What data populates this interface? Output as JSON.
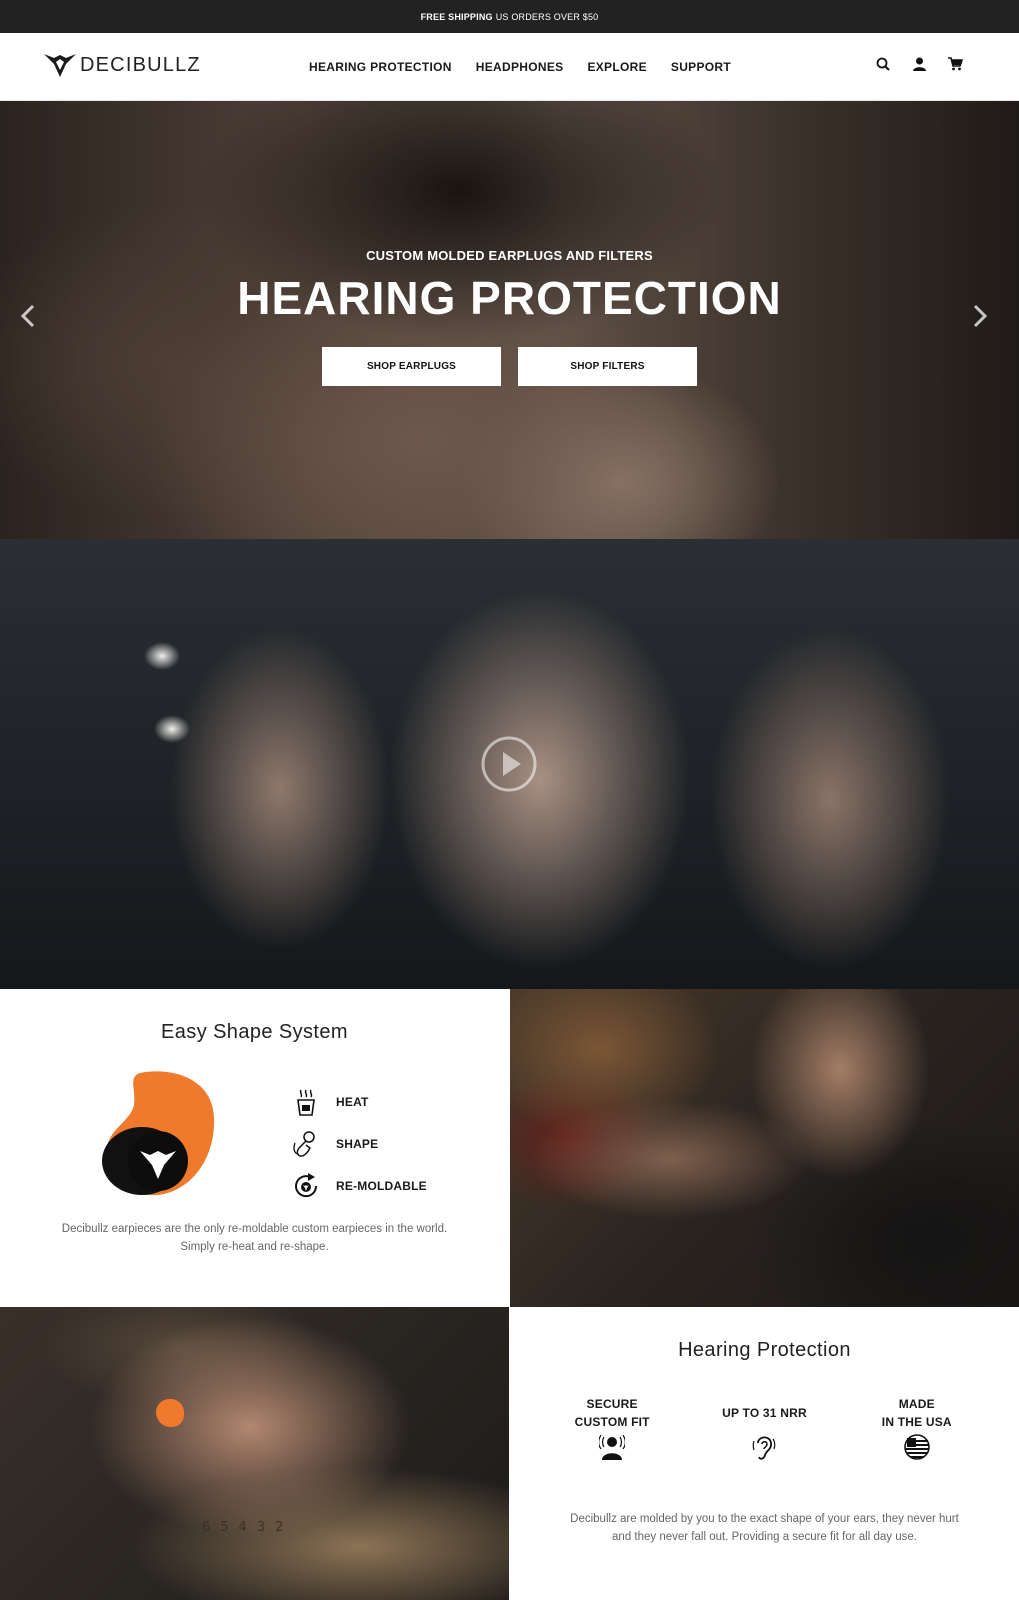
{
  "announcement": {
    "bold": "FREE SHIPPING",
    "text": "US ORDERS OVER $50"
  },
  "header": {
    "logo_text": "DECIBULLZ",
    "nav": [
      {
        "label": "HEARING PROTECTION"
      },
      {
        "label": "HEADPHONES"
      },
      {
        "label": "EXPLORE"
      },
      {
        "label": "SUPPORT"
      }
    ],
    "icons": [
      "search-icon",
      "account-icon",
      "cart-icon"
    ]
  },
  "hero": {
    "subtitle": "CUSTOM MOLDED EARPLUGS AND FILTERS",
    "title": "HEARING PROTECTION",
    "buttons": [
      {
        "label": "SHOP EARPLUGS"
      },
      {
        "label": "SHOP FILTERS"
      }
    ]
  },
  "easy_shape": {
    "title": "Easy Shape System",
    "features": [
      {
        "label": "HEAT",
        "icon": "heat-cup-icon"
      },
      {
        "label": "SHAPE",
        "icon": "shape-hand-icon"
      },
      {
        "label": "RE-MOLDABLE",
        "icon": "remold-icon"
      }
    ],
    "description": "Decibullz earpieces are the only re-moldable custom earpieces in the world. Simply re-heat and re-shape.",
    "accent_color": "#f07a2c"
  },
  "shooter_photo": {
    "numbers": "65432"
  },
  "hearing_protection": {
    "title": "Hearing Protection",
    "features": [
      {
        "label_line1": "SECURE",
        "label_line2": "CUSTOM FIT",
        "icon": "secure-fit-icon"
      },
      {
        "label_line1": "UP TO 31 NRR",
        "label_line2": "",
        "icon": "ear-icon"
      },
      {
        "label_line1": "MADE",
        "label_line2": "IN THE USA",
        "icon": "usa-flag-icon"
      }
    ],
    "description": "Decibullz are molded by you to the exact shape of your ears, they never hurt and they never fall out. Providing a secure fit for all day use."
  }
}
